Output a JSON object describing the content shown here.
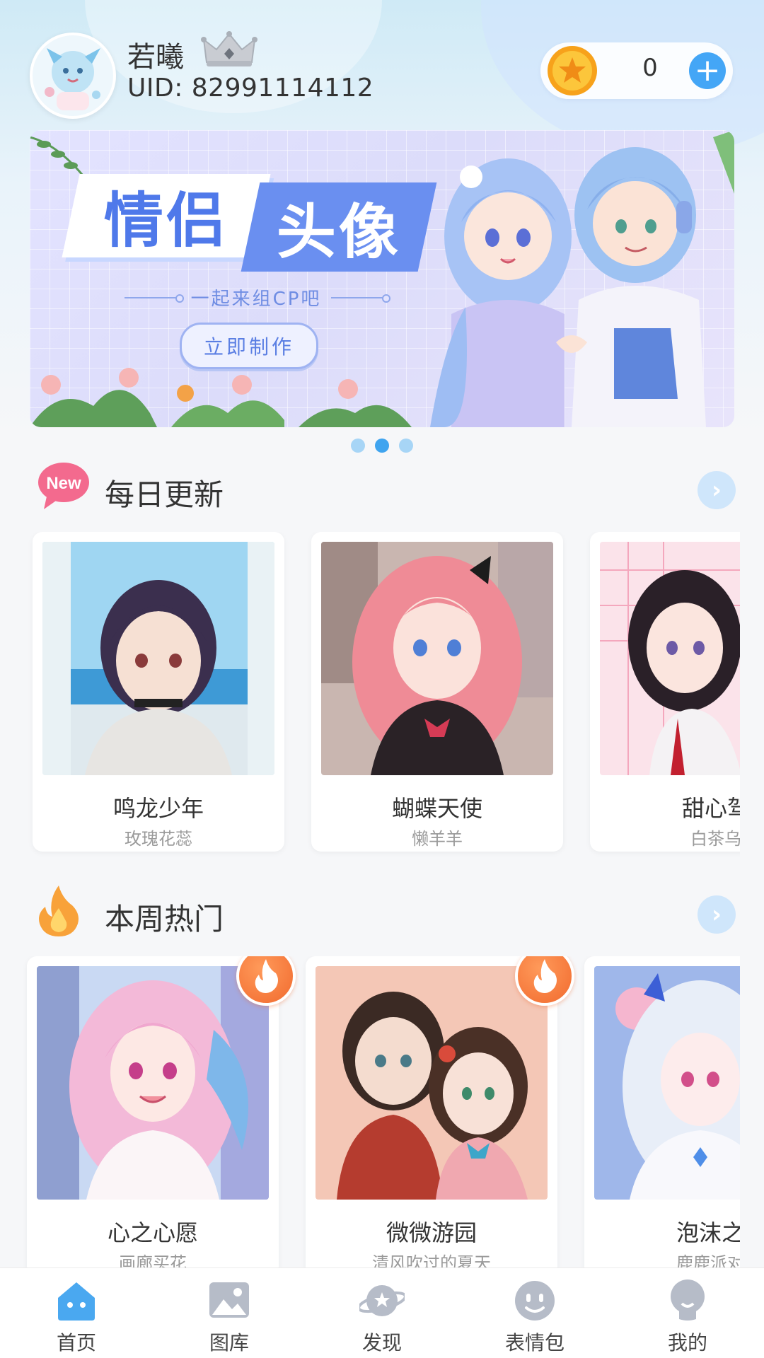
{
  "user": {
    "name": "若曦",
    "uid": "UID: 82991114112",
    "coins": "0"
  },
  "banner": {
    "title_part1": "情侣",
    "title_part2": "头像",
    "subtitle": "一起来组CP吧",
    "cta": "立即制作",
    "page_count": 3,
    "active_page": 2
  },
  "daily": {
    "title": "每日更新",
    "badge": "New",
    "items": [
      {
        "title": "鸣龙少年",
        "author": "玫瑰花蕊"
      },
      {
        "title": "蝴蝶天使",
        "author": "懒羊羊"
      },
      {
        "title": "甜心驾",
        "author": "白茶乌"
      }
    ]
  },
  "weekly": {
    "title": "本周热门",
    "items": [
      {
        "title": "心之心愿",
        "author": "画廊买花",
        "hot": true
      },
      {
        "title": "微微游园",
        "author": "清风吹过的夏天",
        "hot": true
      },
      {
        "title": "泡沫之",
        "author": "鹿鹿派对",
        "hot": false
      }
    ]
  },
  "tabs": [
    {
      "label": "首页",
      "icon": "home-icon",
      "active": true
    },
    {
      "label": "图库",
      "icon": "gallery-icon",
      "active": false
    },
    {
      "label": "发现",
      "icon": "planet-icon",
      "active": false
    },
    {
      "label": "表情包",
      "icon": "smiley-icon",
      "active": false
    },
    {
      "label": "我的",
      "icon": "profile-icon",
      "active": false
    }
  ],
  "colors": {
    "accent": "#3fa4ef",
    "tab_active": "#4aa8f0",
    "tab_inactive": "#b6bcc8",
    "hot": "#f16a2e"
  }
}
